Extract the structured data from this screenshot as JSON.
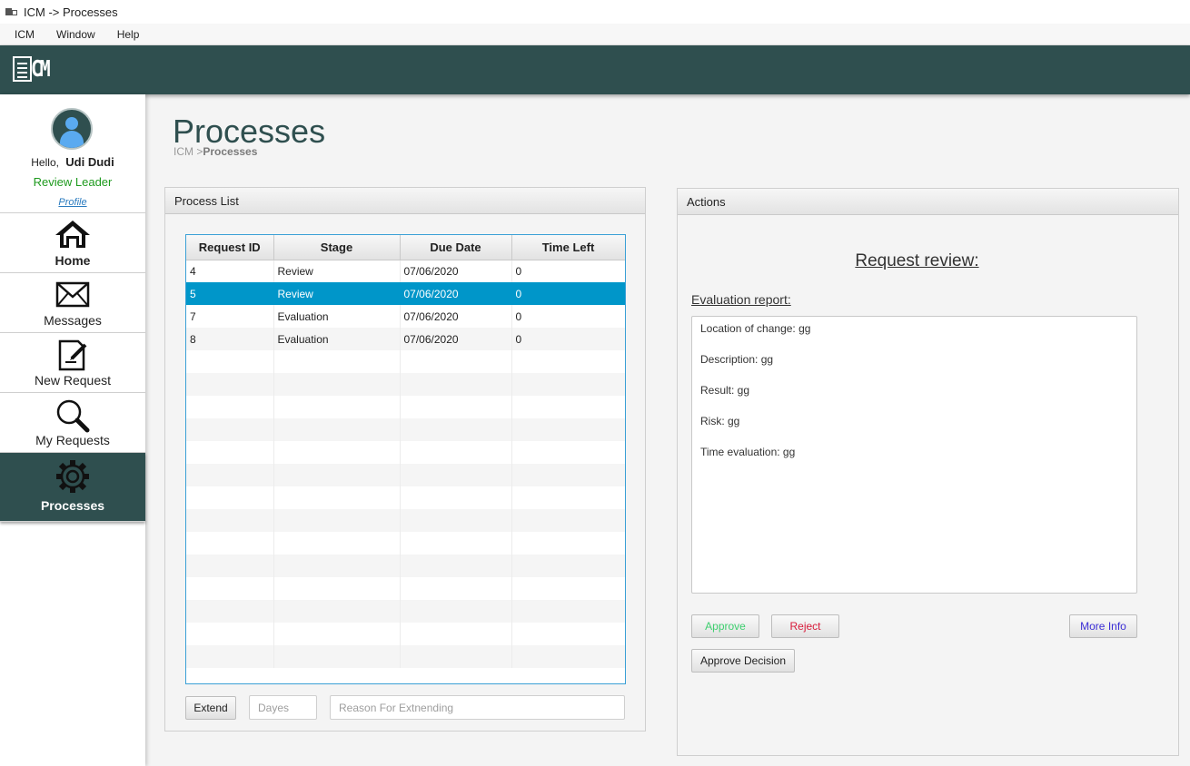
{
  "window": {
    "title": "ICM -> Processes"
  },
  "menubar": {
    "items": [
      "ICM",
      "Window",
      "Help"
    ]
  },
  "header": {
    "logo_text": "CM",
    "bg_color": "#2f4f4f"
  },
  "sidebar": {
    "greeting": "Hello,",
    "user_name": "Udi Dudi",
    "role": "Review Leader",
    "profile_link": "Profile",
    "nav": [
      {
        "label": "Home",
        "icon": "home-icon"
      },
      {
        "label": "Messages",
        "icon": "envelope-icon"
      },
      {
        "label": "New Request",
        "icon": "new-document-icon"
      },
      {
        "label": "My Requests",
        "icon": "magnifier-icon"
      },
      {
        "label": "Processes",
        "icon": "gear-icon",
        "active": true
      }
    ]
  },
  "page": {
    "title": "Processes",
    "breadcrumb_root": "ICM",
    "breadcrumb_sep": " >",
    "breadcrumb_current": "Processes"
  },
  "process_list": {
    "title": "Process List",
    "columns": [
      "Request ID",
      "Stage",
      "Due Date",
      "Time Left"
    ],
    "rows": [
      [
        "4",
        "Review",
        "07/06/2020",
        "0"
      ],
      [
        "5",
        "Review",
        "07/06/2020",
        "0"
      ],
      [
        "7",
        "Evaluation",
        "07/06/2020",
        "0"
      ],
      [
        "8",
        "Evaluation",
        "07/06/2020",
        "0"
      ]
    ],
    "selected_row_index": 1,
    "extend_label": "Extend",
    "days_placeholder": "Dayes",
    "reason_placeholder": "Reason For Extnending"
  },
  "actions": {
    "title": "Actions",
    "review_title": "Request review:",
    "evaluation_label": "Evaluation report:",
    "report_lines": [
      "Location of change: gg",
      "Description: gg",
      "Result: gg",
      "Risk: gg",
      "Time evaluation: gg"
    ],
    "approve_label": "Approve",
    "reject_label": "Reject",
    "more_info_label": "More Info",
    "approve_decision_label": "Approve Decision"
  }
}
